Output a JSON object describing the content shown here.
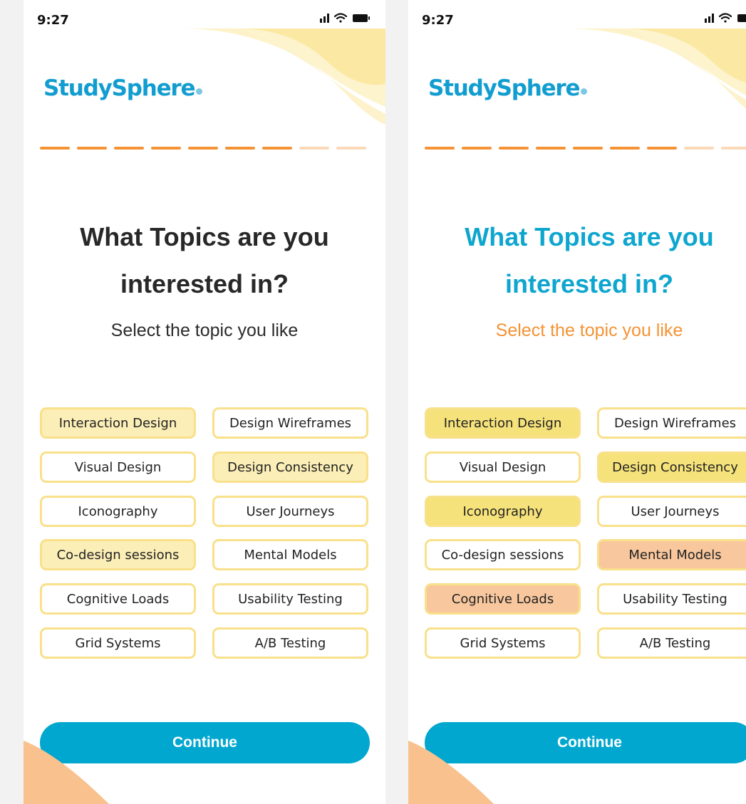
{
  "colors": {
    "brand_blue": "#129dd0",
    "cta_blue": "#02a7cf",
    "accent_orange": "#f49335",
    "chip_border_yellow": "#f9e08a",
    "chip_light_selected": "#fbeeb6",
    "chip_yellow_selected": "#f6e27a",
    "chip_peach_selected": "#f8c79d",
    "blob_yellow": "#fbe9a3",
    "blob_peach": "#f8c18e"
  },
  "status_icons": [
    "signal-icon",
    "wifi-icon",
    "battery-icon"
  ],
  "progress": {
    "completed_steps": 7,
    "total_steps": 9
  },
  "screens": [
    {
      "status_time": "9:27",
      "logo": "StudySphere",
      "title_line1": "What Topics are you",
      "title_line2": "interested in?",
      "subtitle": "Select the topic you like",
      "title_color": "#282828",
      "subtitle_color": "#2b2b2b",
      "chips": [
        {
          "label": "Interaction Design",
          "state": "light"
        },
        {
          "label": "Design Wireframes",
          "state": "none"
        },
        {
          "label": "Visual Design",
          "state": "none"
        },
        {
          "label": "Design Consistency",
          "state": "light"
        },
        {
          "label": "Iconography",
          "state": "none"
        },
        {
          "label": "User Journeys",
          "state": "none"
        },
        {
          "label": "Co-design sessions",
          "state": "light"
        },
        {
          "label": "Mental Models",
          "state": "none"
        },
        {
          "label": "Cognitive Loads",
          "state": "none"
        },
        {
          "label": "Usability Testing",
          "state": "none"
        },
        {
          "label": "Grid Systems",
          "state": "none"
        },
        {
          "label": "A/B Testing",
          "state": "none"
        }
      ],
      "continue_label": "Continue"
    },
    {
      "status_time": "9:27",
      "logo": "StudySphere",
      "title_line1": "What Topics are you",
      "title_line2": "interested in?",
      "subtitle": "Select the topic you like",
      "title_color": "#0ea6cf",
      "subtitle_color": "#f49335",
      "chips": [
        {
          "label": "Interaction Design",
          "state": "yellow"
        },
        {
          "label": "Design Wireframes",
          "state": "none"
        },
        {
          "label": "Visual Design",
          "state": "none"
        },
        {
          "label": "Design Consistency",
          "state": "yellow"
        },
        {
          "label": "Iconography",
          "state": "yellow"
        },
        {
          "label": "User Journeys",
          "state": "none"
        },
        {
          "label": "Co-design sessions",
          "state": "none"
        },
        {
          "label": "Mental Models",
          "state": "peach"
        },
        {
          "label": "Cognitive Loads",
          "state": "peach"
        },
        {
          "label": "Usability Testing",
          "state": "none"
        },
        {
          "label": "Grid Systems",
          "state": "none"
        },
        {
          "label": "A/B Testing",
          "state": "none"
        }
      ],
      "continue_label": "Continue"
    }
  ]
}
